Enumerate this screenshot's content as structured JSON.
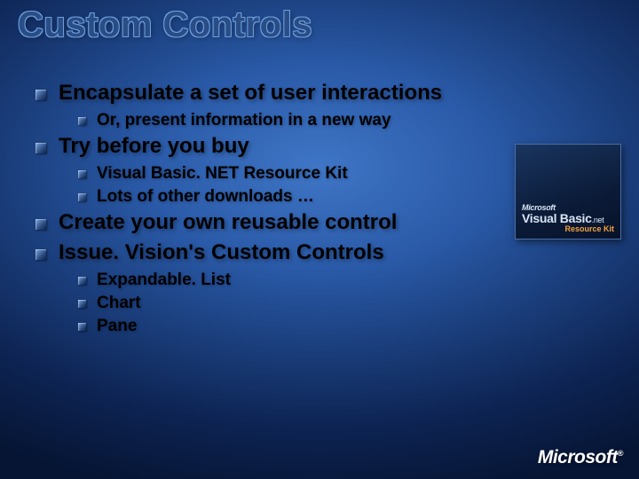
{
  "title": "Custom Controls",
  "bullets": {
    "b1": "Encapsulate a set of user interactions",
    "b1a": "Or, present information in a new way",
    "b2": "Try before you buy",
    "b2a": "Visual Basic. NET Resource Kit",
    "b2b": "Lots of other downloads …",
    "b3": "Create your own reusable control",
    "b4": "Issue. Vision's Custom Controls",
    "b4a": "Expandable. List",
    "b4b": "Chart",
    "b4c": "Pane"
  },
  "boxart": {
    "ms": "Microsoft",
    "product_line1": "Visual Basic",
    "product_dotnet": ".net",
    "subtitle": "Resource Kit"
  },
  "footer": {
    "logo": "Microsoft",
    "reg": "®"
  }
}
